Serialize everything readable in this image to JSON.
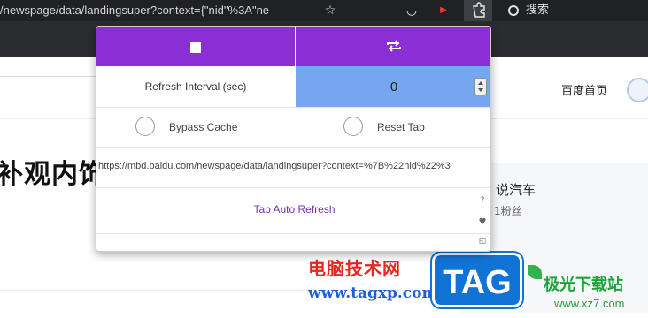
{
  "browser": {
    "address_text": "/newspage/data/landingsuper?context={\"nid\"%3A\"ne",
    "search_label": "搜索",
    "icons": [
      "star-icon",
      "pocket-icon",
      "extension-icon",
      "puzzle-icon",
      "search-icon"
    ]
  },
  "page": {
    "home_link": "百度首页",
    "headline": "补观内饰",
    "author_name": "说汽车",
    "author_fans": "1粉丝"
  },
  "popup": {
    "refresh_interval_label": "Refresh Interval (sec)",
    "refresh_interval_value": "0",
    "bypass_cache_label": "Bypass Cache",
    "reset_tab_label": "Reset Tab",
    "url": "https://mbd.baidu.com/newspage/data/landingsuper?context=%7B%22nid%22%3",
    "title": "Tab Auto Refresh",
    "help_symbol": "?",
    "accent_color": "#8a2fd4",
    "input_color": "#76a6ef"
  },
  "watermark": {
    "line1": "电脑技术网",
    "line2": "www.tagxp.com",
    "badge": "TAG",
    "site_name": "极光下载站",
    "site_url": "www.xz7.com"
  }
}
